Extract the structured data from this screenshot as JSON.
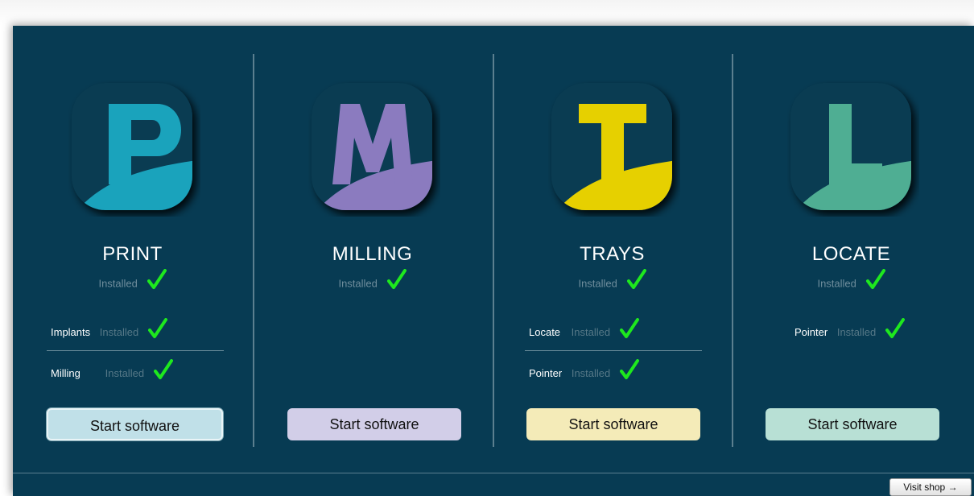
{
  "apps": [
    {
      "title": "PRINT",
      "letter": "P",
      "status": "Installed",
      "accent": "#1aa3bc",
      "button_bg": "#c0e0e8",
      "button_label": "Start software",
      "modules": [
        {
          "name": "Implants",
          "status": "Installed"
        },
        {
          "name": "Milling",
          "status": "Installed"
        }
      ]
    },
    {
      "title": "MILLING",
      "letter": "M",
      "status": "Installed",
      "accent": "#8b7bbf",
      "button_bg": "#d2cee8",
      "button_label": "Start software",
      "modules": []
    },
    {
      "title": "TRAYS",
      "letter": "T",
      "status": "Installed",
      "accent": "#e6d000",
      "button_bg": "#f4ebb8",
      "button_label": "Start software",
      "modules": [
        {
          "name": "Locate",
          "status": "Installed"
        },
        {
          "name": "Pointer",
          "status": "Installed"
        }
      ]
    },
    {
      "title": "LOCATE",
      "letter": "L",
      "status": "Installed",
      "accent": "#4fae93",
      "button_bg": "#b8e0d5",
      "button_label": "Start software",
      "modules": [
        {
          "name": "Pointer",
          "status": "Installed"
        }
      ]
    }
  ],
  "footer": {
    "visit_shop_label": "Visit shop →"
  },
  "colors": {
    "panel_bg": "#073b53",
    "check": "#1ee81e"
  }
}
